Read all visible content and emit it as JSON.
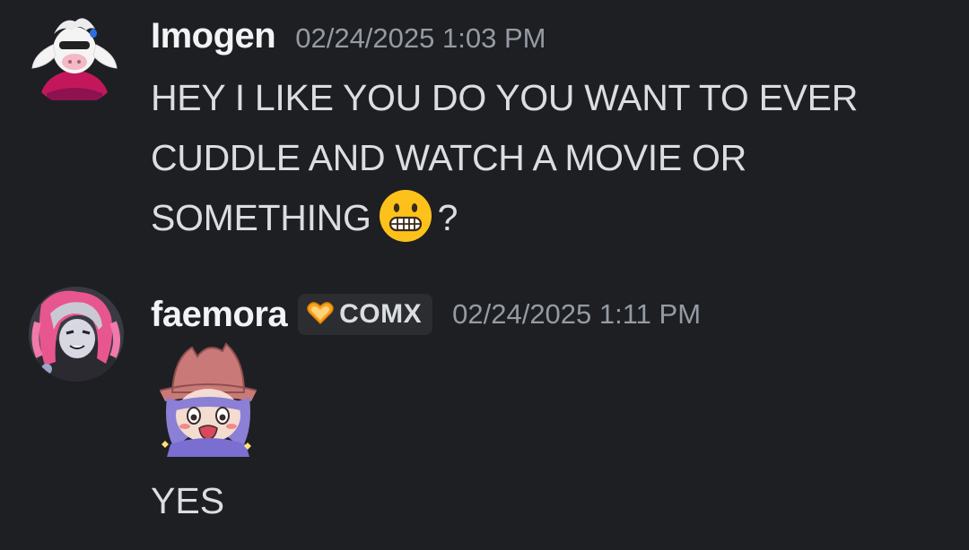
{
  "messages": [
    {
      "username": "Imogen",
      "timestamp": "02/24/2025 1:03 PM",
      "lines": [
        "HEY  I LIKE YOU DO YOU WANT TO EVER",
        "CUDDLE AND WATCH A MOVIE OR",
        "SOMETHING"
      ],
      "line_suffix": "?",
      "emoji": "grimacing-face-emoji",
      "avatar": "cow-character-avatar"
    },
    {
      "username": "faemora",
      "tag": {
        "label": "COMX",
        "icon": "heart-icon",
        "color": "#f5a623"
      },
      "timestamp": "02/24/2025 1:11 PM",
      "sticker": "purple-hair-hat-character-sticker",
      "text": "YES",
      "avatar": "pink-hair-character-avatar"
    }
  ],
  "colors": {
    "background": "#1e1f22",
    "text": "#dbdee1",
    "username": "#f2f3f5",
    "timestamp": "#949ba4"
  }
}
